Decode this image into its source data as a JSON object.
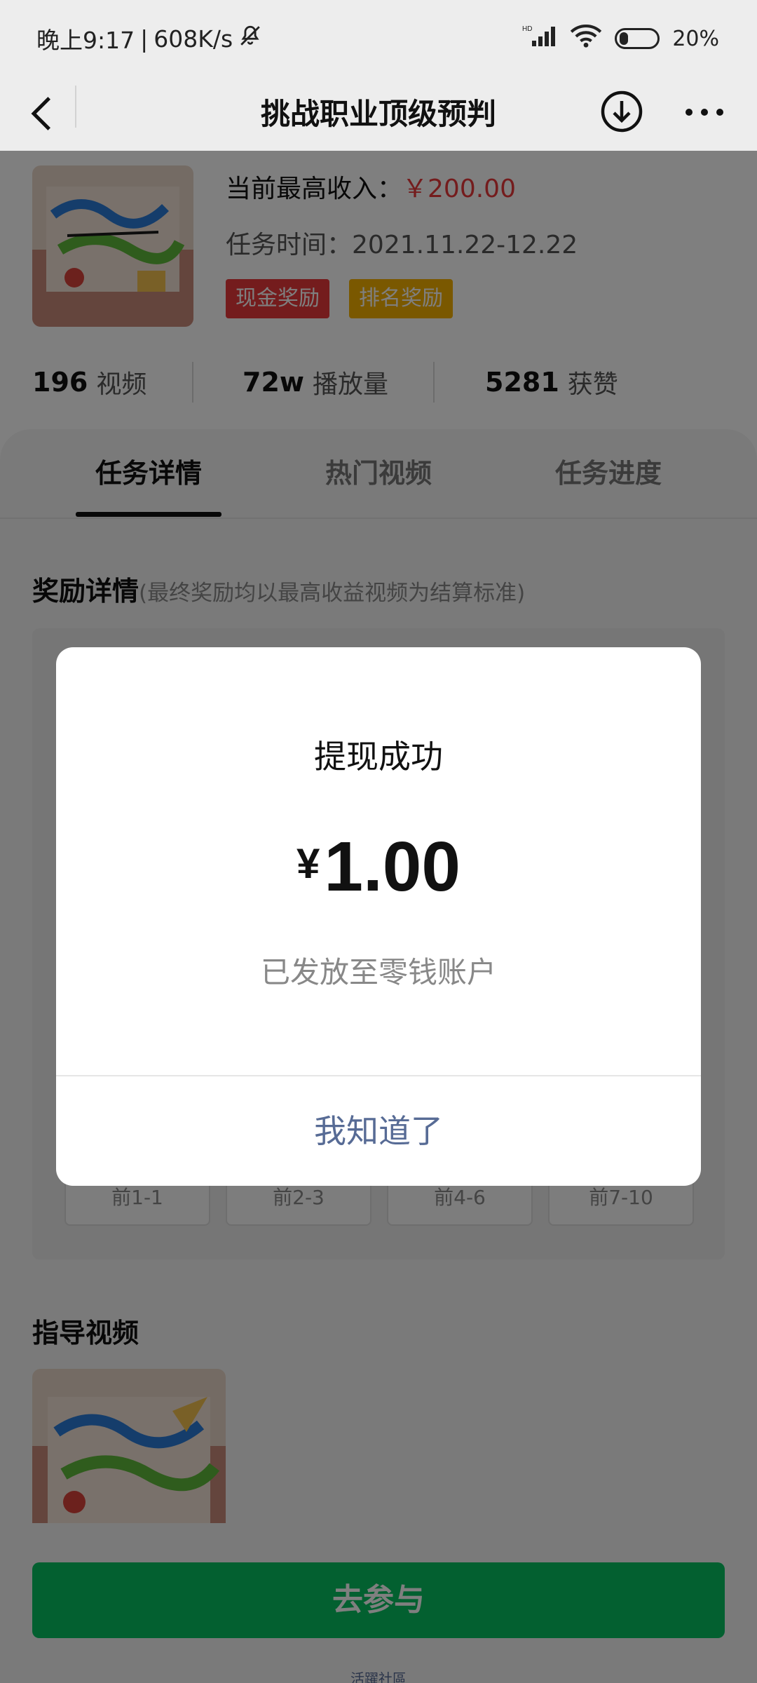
{
  "status_bar": {
    "time": "晚上9:17",
    "speed": "608K/s",
    "network": "HD",
    "battery": "20%"
  },
  "nav": {
    "title": "挑战职业顶级预判"
  },
  "task": {
    "income_label": "当前最高收入：",
    "income_value": "￥200.00",
    "time_label": "任务时间：",
    "time_value": "2021.11.22-12.22",
    "tags": [
      "现金奖励",
      "排名奖励"
    ]
  },
  "stats": [
    {
      "value": "196",
      "label": "视频"
    },
    {
      "value": "72w",
      "label": "播放量"
    },
    {
      "value": "5281",
      "label": "获赞"
    }
  ],
  "tabs": [
    "任务详情",
    "热门视频",
    "任务进度"
  ],
  "reward_section": {
    "title": "奖励详情",
    "note": "(最终奖励均以最高收益视频为结算标准)",
    "ranks": [
      "前1-1",
      "前2-3",
      "前4-6",
      "前7-10"
    ]
  },
  "guide_section": {
    "title": "指导视频"
  },
  "join_button": "去参与",
  "footer_link": "活躍社區",
  "dialog": {
    "title": "提现成功",
    "currency": "¥",
    "amount": "1.00",
    "subtitle": "已发放至零钱账户",
    "confirm": "我知道了"
  },
  "colors": {
    "price_red": "#e8393a",
    "cash_tag": "#e8393a",
    "rank_tag": "#f5b100",
    "primary_green": "#07c160",
    "link_blue": "#576b95"
  }
}
